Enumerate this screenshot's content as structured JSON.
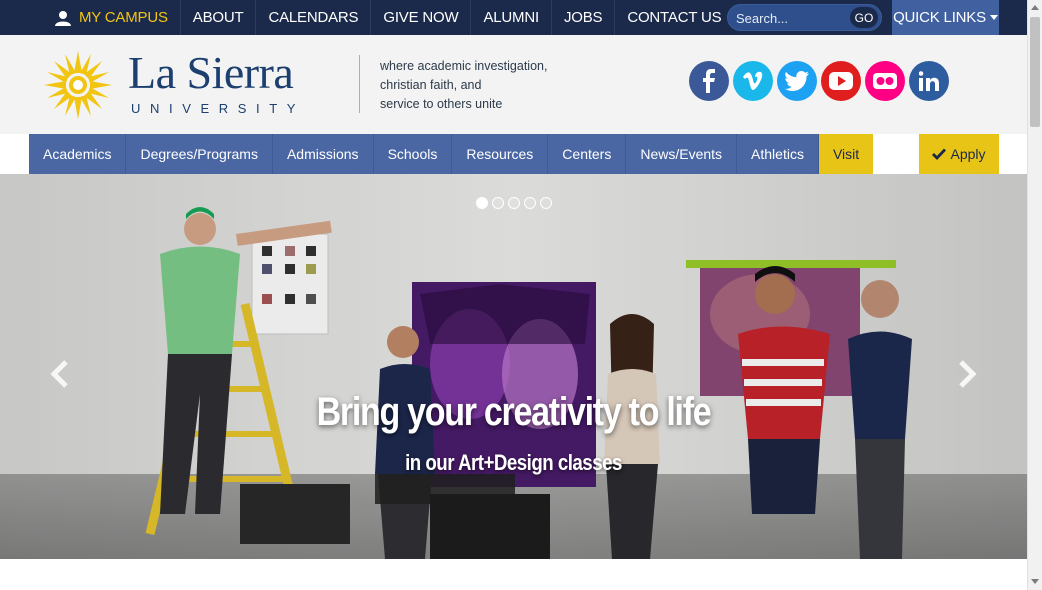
{
  "topbar": {
    "my_campus": "MY CAMPUS",
    "links": [
      "ABOUT",
      "CALENDARS",
      "GIVE NOW",
      "ALUMNI",
      "JOBS",
      "CONTACT US"
    ],
    "search_placeholder": "Search...",
    "search_button": "GO",
    "quick_links": "QUICK LINKS"
  },
  "header": {
    "brand_name": "La Sierra",
    "brand_sub": "UNIVERSITY",
    "tagline": [
      "where academic investigation,",
      "christian faith, and",
      "service to others unite"
    ],
    "social": [
      {
        "icon": "facebook-icon",
        "glyph": "f",
        "color": "#3b5998"
      },
      {
        "icon": "vimeo-icon",
        "glyph": "v",
        "color": "#1ab7ea"
      },
      {
        "icon": "twitter-icon",
        "glyph": "t",
        "color": "#1da1f2"
      },
      {
        "icon": "youtube-icon",
        "glyph": "▶",
        "color": "#e01e1e"
      },
      {
        "icon": "flickr-icon",
        "glyph": "••",
        "color": "#ff0084"
      },
      {
        "icon": "linkedin-icon",
        "glyph": "in",
        "color": "#2e5d9f"
      }
    ]
  },
  "nav": {
    "items": [
      "Academics",
      "Degrees/Programs",
      "Admissions",
      "Schools",
      "Resources",
      "Centers",
      "News/Events",
      "Athletics",
      "Visit"
    ],
    "apply": "Apply"
  },
  "hero": {
    "title": "Bring your creativity to life",
    "subtitle": "in our Art+Design classes",
    "slides": 5,
    "active_slide": 0
  },
  "colors": {
    "navy": "#1b2a4a",
    "nav_blue": "#4a67a4",
    "gold": "#e8c417"
  }
}
